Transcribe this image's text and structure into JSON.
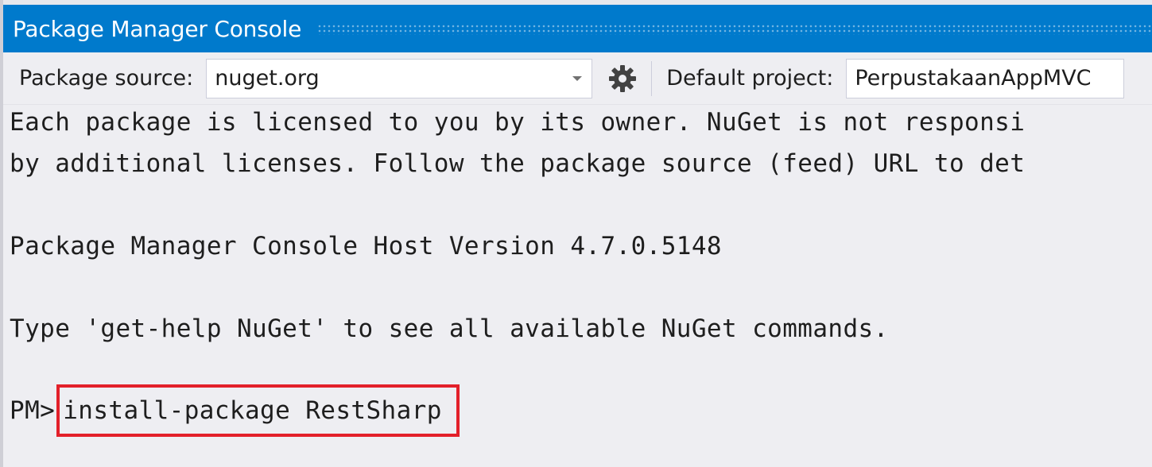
{
  "window": {
    "title": "Package Manager Console"
  },
  "toolbar": {
    "source_label": "Package source:",
    "source_value": "nuget.org",
    "project_label": "Default project:",
    "project_value": "PerpustakaanAppMVC"
  },
  "console": {
    "lines": [
      "Each package is licensed to you by its owner. NuGet is not responsi",
      "by additional licenses. Follow the package source (feed) URL to det",
      "",
      "Package Manager Console Host Version 4.7.0.5148",
      "",
      "Type 'get-help NuGet' to see all available NuGet commands.",
      ""
    ],
    "prompt": "PM>",
    "command": "install-package RestSharp"
  },
  "colors": {
    "title_bar": "#007acc",
    "highlight_box": "#e3202a",
    "background": "#eeeef2"
  },
  "icons": {
    "settings": "gear-icon",
    "dropdown": "chevron-down-icon"
  }
}
